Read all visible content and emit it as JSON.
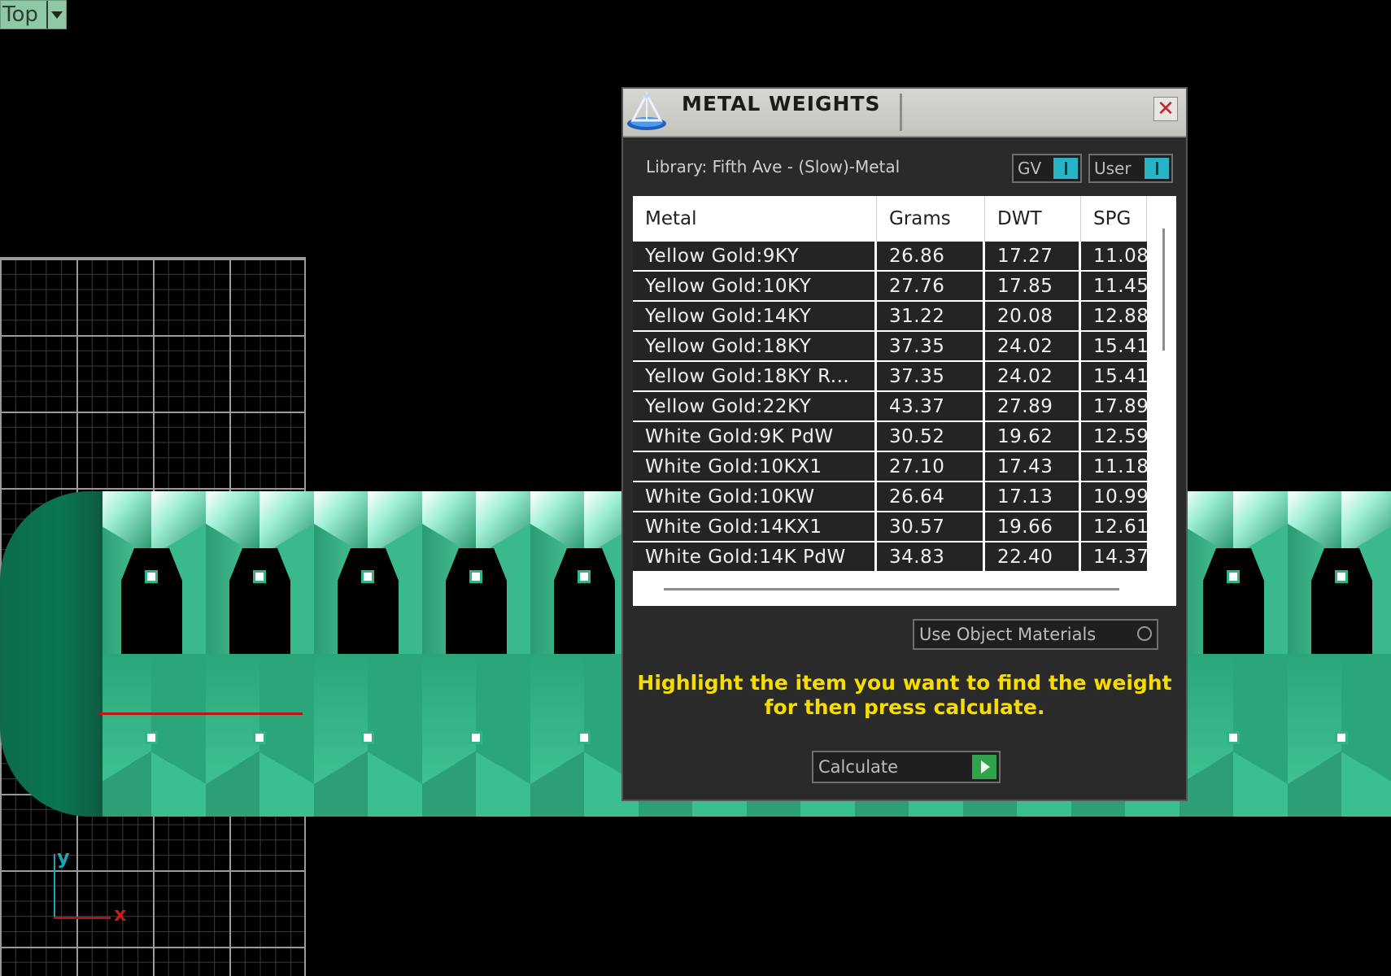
{
  "viewport": {
    "name": "Top",
    "axis_y": "y",
    "axis_x": "x"
  },
  "dialog": {
    "title": "METAL WEIGHTS",
    "close_symbol": "✕",
    "library_label": "Library: Fifth Ave - (Slow)-Metal",
    "toggle_gv": "GV",
    "toggle_user": "User",
    "use_object_materials": "Use Object Materials",
    "hint_line1": "Highlight the item you want to find the weight",
    "hint_line2": "for then press calculate.",
    "calculate_label": "Calculate",
    "icon": "scale-icon"
  },
  "table": {
    "headers": [
      "Metal",
      "Grams",
      "DWT",
      "SPG"
    ],
    "rows": [
      [
        "Yellow Gold:9KY",
        "26.86",
        "17.27",
        "11.08"
      ],
      [
        "Yellow Gold:10KY",
        "27.76",
        "17.85",
        "11.45"
      ],
      [
        "Yellow Gold:14KY",
        "31.22",
        "20.08",
        "12.88"
      ],
      [
        "Yellow Gold:18KY",
        "37.35",
        "24.02",
        "15.41"
      ],
      [
        "Yellow Gold:18KY R...",
        "37.35",
        "24.02",
        "15.41"
      ],
      [
        "Yellow Gold:22KY",
        "43.37",
        "27.89",
        "17.89"
      ],
      [
        "White Gold:9K PdW",
        "30.52",
        "19.62",
        "12.59"
      ],
      [
        "White Gold:10KX1",
        "27.10",
        "17.43",
        "11.18"
      ],
      [
        "White Gold:10KW",
        "26.64",
        "17.13",
        "10.99"
      ],
      [
        "White Gold:14KX1",
        "30.57",
        "19.66",
        "12.61"
      ],
      [
        "White Gold:14K PdW",
        "34.83",
        "22.40",
        "14.37"
      ]
    ]
  },
  "colors": {
    "accent_teal": "#29b3c4",
    "hint_yellow": "#f7dc00",
    "band_green": "#2fb483",
    "play_green": "#31a34a"
  }
}
